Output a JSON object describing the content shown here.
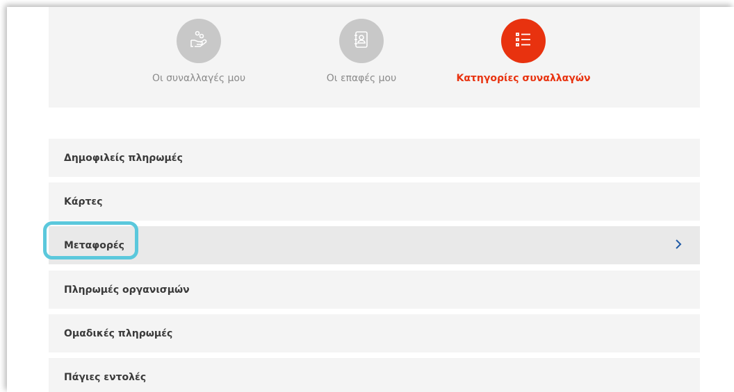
{
  "colors": {
    "accent": "#e8320f",
    "inactive_icon_bg": "#c8c8c8",
    "panel_bg": "#f4f4f4",
    "highlight": "#5bc8dc",
    "chevron": "#1f5aa6"
  },
  "tabs": [
    {
      "label": "Οι συναλλαγές μου",
      "icon": "hand-coins-icon",
      "active": false
    },
    {
      "label": "Οι επαφές μου",
      "icon": "address-book-icon",
      "active": false
    },
    {
      "label": "Κατηγορίες συναλλαγών",
      "icon": "list-icon",
      "active": true
    }
  ],
  "categories": [
    {
      "label": "Δημοφιλείς πληρωμές"
    },
    {
      "label": "Κάρτες"
    },
    {
      "label": "Μεταφορές",
      "selected": true,
      "chevron_icon": "chevron-right-icon"
    },
    {
      "label": "Πληρωμές οργανισμών"
    },
    {
      "label": "Ομαδικές πληρωμές"
    },
    {
      "label": "Πάγιες εντολές"
    }
  ]
}
